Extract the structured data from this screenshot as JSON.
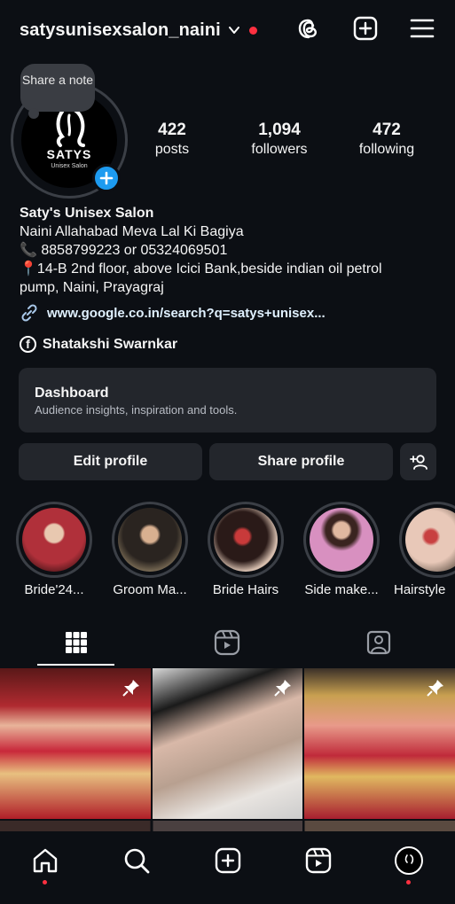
{
  "header": {
    "username": "satysunisexsalon_naini",
    "icons": [
      "chevron-down-icon",
      "threads-icon",
      "new-post-icon",
      "menu-icon"
    ]
  },
  "profile": {
    "note": "Share a note",
    "logo_text": "SATYS",
    "logo_subtext": "Unisex Salon",
    "stats": [
      {
        "value": "422",
        "label": "posts"
      },
      {
        "value": "1,094",
        "label": "followers"
      },
      {
        "value": "472",
        "label": "following"
      }
    ]
  },
  "bio": {
    "name": "Saty's Unisex Salon",
    "line1": "Naini Allahabad Meva Lal Ki Bagiya",
    "phone": "📞 8858799223 or 05324069501",
    "address1": "📍14-B 2nd floor, above Icici Bank,beside indian oil petrol",
    "address2": "pump, Naini, Prayagraj",
    "link": "www.google.co.in/search?q=satys+unisex...",
    "facebook": "Shatakshi Swarnkar"
  },
  "dashboard": {
    "title": "Dashboard",
    "subtitle": "Audience insights, inspiration and tools."
  },
  "buttons": {
    "edit": "Edit profile",
    "share": "Share profile"
  },
  "highlights": [
    {
      "label": "Bride'24...",
      "color": "#8a2a2e"
    },
    {
      "label": "Groom Ma...",
      "color": "#4a3a2e"
    },
    {
      "label": "Bride Hairs",
      "color": "#6a4a3e"
    },
    {
      "label": "Side make...",
      "color": "#9a6a8e"
    },
    {
      "label": "Hairstyle",
      "color": "#7a6a5e"
    }
  ],
  "colors": {
    "background": "#0c0f14",
    "surface": "#23262c",
    "accent": "#1d9bf0",
    "notification": "#ff3040"
  }
}
